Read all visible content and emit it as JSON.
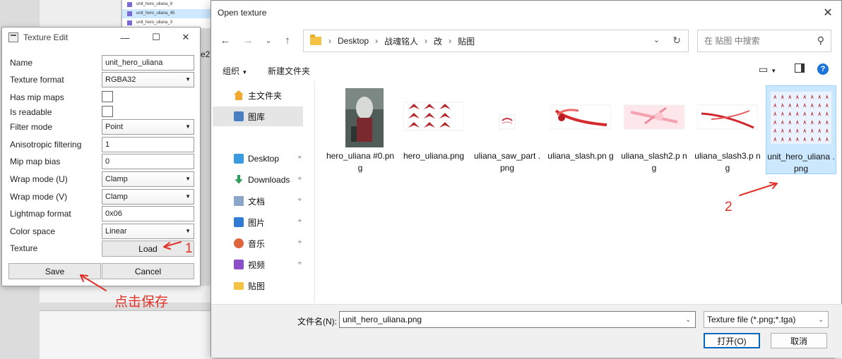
{
  "background": {
    "list_rows": [
      "unit_hero_uliana_8",
      "unit_hero_uliana_45",
      "unit_hero_uliana_3"
    ],
    "partial_text": "e2"
  },
  "texture_edit": {
    "title": "Texture Edit",
    "properties": [
      {
        "label": "Name",
        "value": "unit_hero_uliana",
        "kind": "text"
      },
      {
        "label": "Texture format",
        "value": "RGBA32",
        "kind": "select"
      },
      {
        "label": "Has mip maps",
        "value": "",
        "kind": "check"
      },
      {
        "label": "Is readable",
        "value": "",
        "kind": "check"
      },
      {
        "label": "Filter mode",
        "value": "Point",
        "kind": "select"
      },
      {
        "label": "Anisotropic filtering",
        "value": "1",
        "kind": "text"
      },
      {
        "label": "Mip map bias",
        "value": "0",
        "kind": "text"
      },
      {
        "label": "Wrap mode (U)",
        "value": "Clamp",
        "kind": "select"
      },
      {
        "label": "Wrap mode (V)",
        "value": "Clamp",
        "kind": "select"
      },
      {
        "label": "Lightmap format",
        "value": "0x06",
        "kind": "text"
      },
      {
        "label": "Color space",
        "value": "Linear",
        "kind": "select"
      },
      {
        "label": "Texture",
        "value": "Load",
        "kind": "button"
      }
    ],
    "save_label": "Save",
    "cancel_label": "Cancel"
  },
  "open_dialog": {
    "title": "Open texture",
    "breadcrumbs": [
      "Desktop",
      "战魂铭人",
      "改",
      "贴图"
    ],
    "search_placeholder": "在 贴图 中搜索",
    "toolbar": {
      "organize": "组织",
      "new_folder": "新建文件夹"
    },
    "sidebar": [
      {
        "label": "主文件夹",
        "icon": "home-icon",
        "pinned": false
      },
      {
        "label": "图库",
        "icon": "gallery-icon",
        "pinned": false,
        "selected": true
      },
      {
        "label": "Desktop",
        "icon": "desktop-icon",
        "pinned": true
      },
      {
        "label": "Downloads",
        "icon": "download-icon",
        "pinned": true
      },
      {
        "label": "文档",
        "icon": "document-icon",
        "pinned": true
      },
      {
        "label": "图片",
        "icon": "picture-icon",
        "pinned": true
      },
      {
        "label": "音乐",
        "icon": "music-icon",
        "pinned": true
      },
      {
        "label": "视频",
        "icon": "video-icon",
        "pinned": true
      },
      {
        "label": "贴图",
        "icon": "folder-icon",
        "pinned": false
      }
    ],
    "files": [
      {
        "name": "hero_uliana #0.png"
      },
      {
        "name": "hero_uliana.png"
      },
      {
        "name": "uliana_saw_part .png"
      },
      {
        "name": "uliana_slash.pn g"
      },
      {
        "name": "uliana_slash2.p ng"
      },
      {
        "name": "uliana_slash3.p ng"
      },
      {
        "name": "unit_hero_uliana .png",
        "selected": true
      }
    ],
    "filename_label": "文件名(N):",
    "filename_value": "unit_hero_uliana.png",
    "filetype": "Texture file (*.png;*.tga)",
    "open_label": "打开(O)",
    "cancel_label": "取消"
  },
  "annotations": {
    "step1": "1",
    "step2": "2",
    "save_hint": "点击保存",
    "color": "#e03027"
  }
}
